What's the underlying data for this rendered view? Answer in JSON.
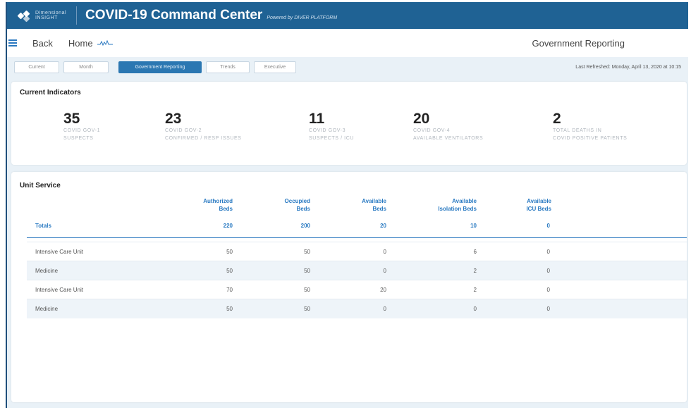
{
  "brand": {
    "logo_text_line1": "Dimensional",
    "logo_text_line2": "INSIGHT"
  },
  "app": {
    "title": "COVID-19 Command Center",
    "powered": "Powered by DIVER PLATFORM"
  },
  "nav": {
    "back": "Back",
    "home": "Home",
    "page_title": "Government Reporting"
  },
  "tabs": [
    {
      "label": "Current"
    },
    {
      "label": "Month"
    },
    {
      "label": "Government Reporting"
    },
    {
      "label": "Trends"
    },
    {
      "label": "Executive"
    }
  ],
  "active_tab": "Government Reporting",
  "last_refreshed": "Last Refreshed: Monday, April 13, 2020 at 10:15",
  "indicators": {
    "title": "Current Indicators",
    "items": [
      {
        "value": "35",
        "line1": "COVID GOV-1",
        "line2": "SUSPECTS"
      },
      {
        "value": "23",
        "line1": "COVID GOV-2",
        "line2": "CONFIRMED / RESP ISSUES"
      },
      {
        "value": "11",
        "line1": "COVID GOV-3",
        "line2": "SUSPECTS / ICU"
      },
      {
        "value": "20",
        "line1": "COVID GOV-4",
        "line2": "AVAILABLE VENTILATORS"
      },
      {
        "value": "2",
        "line1": "TOTAL DEATHS IN",
        "line2": "COVID POSITIVE PATIENTS"
      }
    ]
  },
  "unit_service": {
    "title": "Unit Service",
    "headers": [
      {
        "line1": "Authorized",
        "line2": "Beds"
      },
      {
        "line1": "Occupied",
        "line2": "Beds"
      },
      {
        "line1": "Available",
        "line2": "Beds"
      },
      {
        "line1": "Available",
        "line2": "Isolation Beds"
      },
      {
        "line1": "Available",
        "line2": "ICU Beds"
      }
    ],
    "totals": {
      "label": "Totals",
      "values": [
        "220",
        "200",
        "20",
        "10",
        "0"
      ]
    },
    "rows": [
      {
        "name": "Intensive Care Unit",
        "values": [
          "50",
          "50",
          "0",
          "6",
          "0"
        ]
      },
      {
        "name": "Medicine",
        "values": [
          "50",
          "50",
          "0",
          "2",
          "0"
        ]
      },
      {
        "name": "Intensive Care Unit",
        "values": [
          "70",
          "50",
          "20",
          "2",
          "0"
        ]
      },
      {
        "name": "Medicine",
        "values": [
          "50",
          "50",
          "0",
          "0",
          "0"
        ]
      }
    ]
  },
  "colors": {
    "header_bg": "#1f6294",
    "accent": "#2a7ac2",
    "active_tab": "#2b77b2"
  }
}
